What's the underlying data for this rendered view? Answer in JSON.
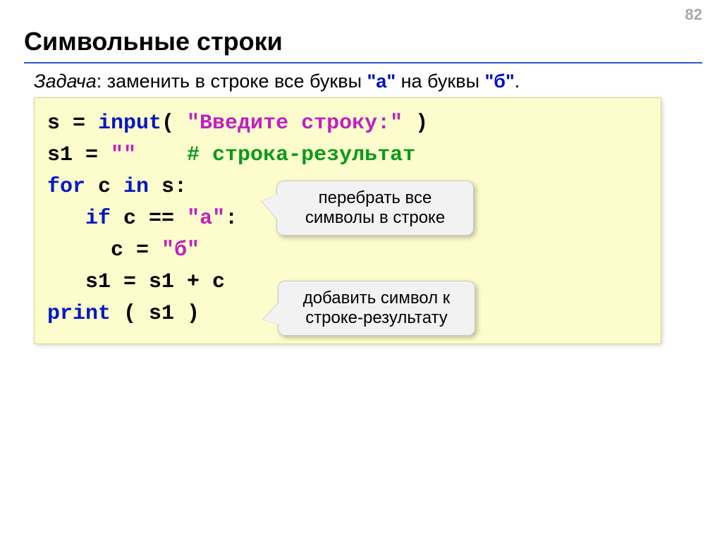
{
  "page_number": "82",
  "title": "Символьные строки",
  "task": {
    "label_italic": "Задача",
    "text_before": ": заменить в строке все буквы ",
    "quote1": "\"а\"",
    "text_mid": " на буквы ",
    "quote2": "\"б\"",
    "text_end": "."
  },
  "code": {
    "l1_a": "s = ",
    "l1_kw": "input",
    "l1_b": "( ",
    "l1_str": "\"Введите строку:\"",
    "l1_c": " )",
    "l2_a": "s1 = ",
    "l2_str": "\"\"",
    "l2_b": "    ",
    "l2_cmt": "# строка-результат",
    "l3_kw1": "for",
    "l3_a": " c ",
    "l3_kw2": "in",
    "l3_b": " s:",
    "l4_ind": "   ",
    "l4_kw": "if",
    "l4_a": " c == ",
    "l4_str": "\"а\"",
    "l4_b": ":",
    "l5_ind": "     ",
    "l5_a": "c = ",
    "l5_str": "\"б\"",
    "l6_ind": "   ",
    "l6_a": "s1 = s1 + c",
    "l7_kw": "print",
    "l7_a": " ( s1 )"
  },
  "callout1_l1": "перебрать все",
  "callout1_l2": "символы в строке",
  "callout2_l1": "добавить символ к",
  "callout2_l2": "строке-результату"
}
